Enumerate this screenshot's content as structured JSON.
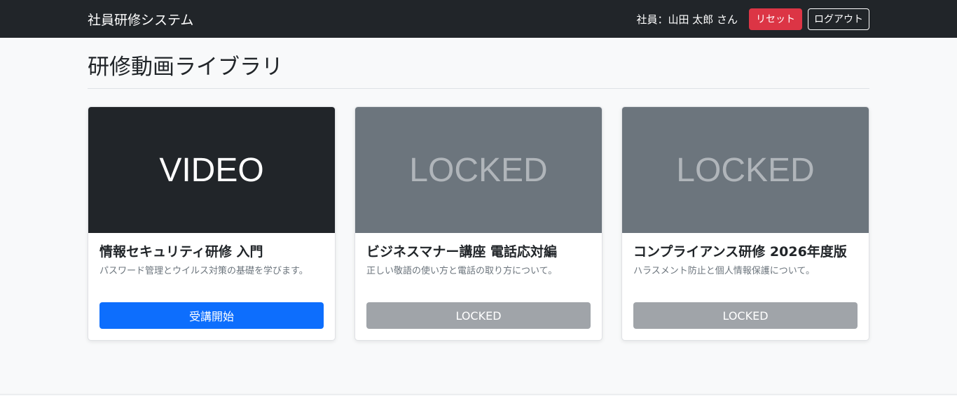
{
  "navbar": {
    "brand": "社員研修システム",
    "user_label": "社員：山田 太郎 さん",
    "reset_label": "リセット",
    "logout_label": "ログアウト"
  },
  "page": {
    "title": "研修動画ライブラリ"
  },
  "cards": [
    {
      "thumb_text": "VIDEO",
      "title": "情報セキュリティ研修 入門",
      "description": "パスワード管理とウイルス対策の基礎を学びます。",
      "button_label": "受講開始",
      "locked": false
    },
    {
      "thumb_text": "LOCKED",
      "title": "ビジネスマナー講座 電話応対編",
      "description": "正しい敬語の使い方と電話の取り方について。",
      "button_label": "LOCKED",
      "locked": true
    },
    {
      "thumb_text": "LOCKED",
      "title": "コンプライアンス研修 2026年度版",
      "description": "ハラスメント防止と個人情報保護について。",
      "button_label": "LOCKED",
      "locked": true
    }
  ],
  "colors": {
    "navbar_bg": "#212529",
    "reset_button": "#dc3545",
    "primary_button": "#0d6efd",
    "locked_thumb": "#6c757d",
    "locked_button": "#a0a4a9"
  }
}
